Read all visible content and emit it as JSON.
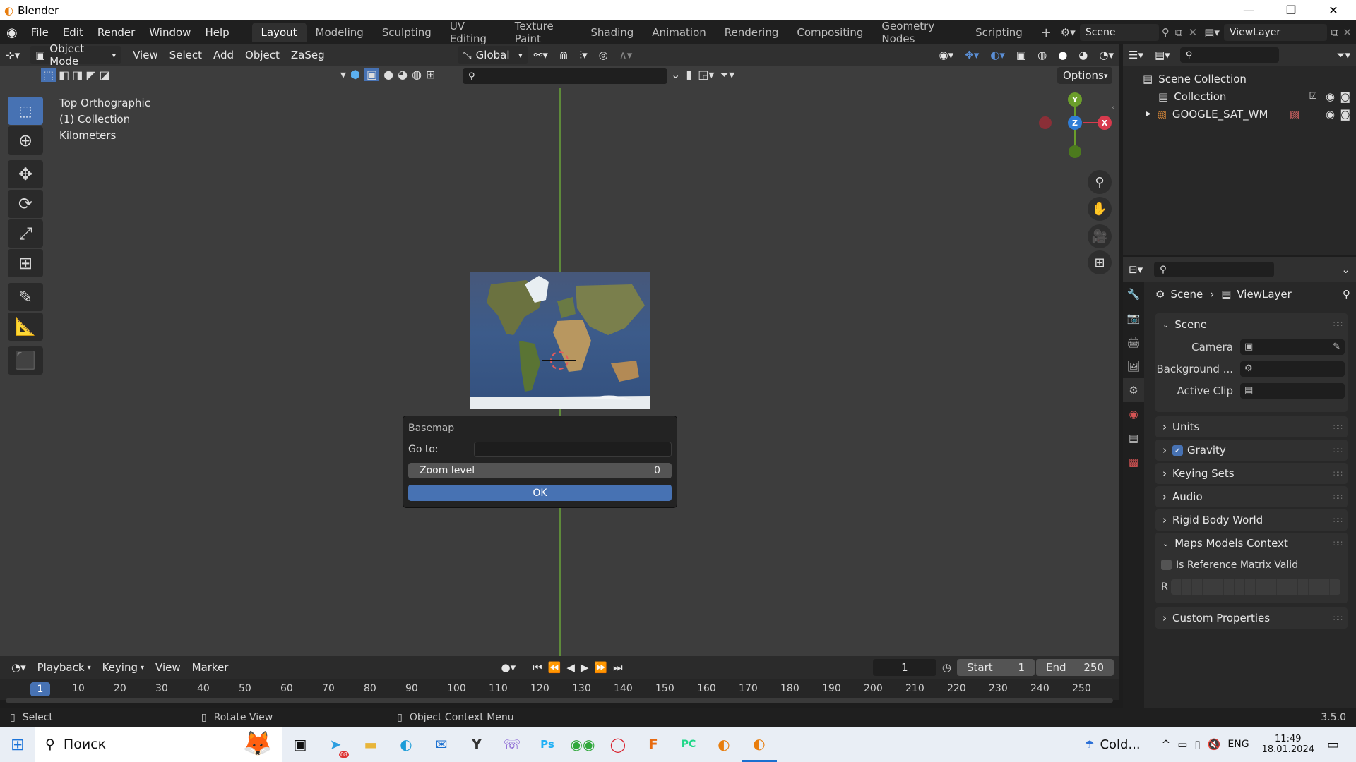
{
  "window": {
    "title": "Blender",
    "minimize": "—",
    "restore": "❐",
    "close": "✕"
  },
  "menus": [
    "File",
    "Edit",
    "Render",
    "Window",
    "Help"
  ],
  "workspaces": [
    "Layout",
    "Modeling",
    "Sculpting",
    "UV Editing",
    "Texture Paint",
    "Shading",
    "Animation",
    "Rendering",
    "Compositing",
    "Geometry Nodes",
    "Scripting"
  ],
  "active_workspace": "Layout",
  "scene_name": "Scene",
  "view_layer": "ViewLayer",
  "header": {
    "mode": "Object Mode",
    "menus": [
      "View",
      "Select",
      "Add",
      "Object",
      "ZaSeg"
    ],
    "orientation": "Global",
    "options": "Options"
  },
  "viewport": {
    "view_name": "Top Orthographic",
    "collection": "(1) Collection",
    "units": "Kilometers",
    "gizmo": {
      "y": "Y",
      "z": "Z",
      "x": "X"
    }
  },
  "dialog": {
    "title": "Basemap",
    "goto_label": "Go to:",
    "goto_value": "",
    "zoom_label": "Zoom level",
    "zoom_value": "0",
    "ok": "OK"
  },
  "outliner": {
    "root": "Scene Collection",
    "items": [
      "Collection",
      "GOOGLE_SAT_WM"
    ]
  },
  "properties": {
    "breadcrumb_scene": "Scene",
    "breadcrumb_layer": "ViewLayer",
    "scene_panel": "Scene",
    "camera_label": "Camera",
    "background_label": "Background ...",
    "active_clip_label": "Active Clip",
    "panels": [
      "Units",
      "Gravity",
      "Keying Sets",
      "Audio",
      "Rigid Body World"
    ],
    "maps_panel": "Maps Models Context",
    "ref_matrix": "Is Reference Matrix Valid",
    "r_label": "R",
    "custom_props": "Custom Properties"
  },
  "timeline": {
    "menus": [
      "Playback",
      "Keying",
      "View",
      "Marker"
    ],
    "current_frame": "1",
    "start_label": "Start",
    "start": "1",
    "end_label": "End",
    "end": "250",
    "ticks": [
      "10",
      "20",
      "30",
      "40",
      "50",
      "60",
      "70",
      "80",
      "90",
      "100",
      "110",
      "120",
      "130",
      "140",
      "150",
      "160",
      "170",
      "180",
      "190",
      "200",
      "210",
      "220",
      "230",
      "240",
      "250"
    ],
    "marker_frame": "1"
  },
  "status": {
    "select": "Select",
    "rotate": "Rotate View",
    "context": "Object Context Menu",
    "version": "3.5.0"
  },
  "taskbar": {
    "search": "Поиск",
    "weather": "Cold...",
    "lang": "ENG",
    "time": "11:49",
    "date": "18.01.2024",
    "telegram_badge": "08"
  },
  "colors": {
    "accent": "#4772b3",
    "x_axis": "#d83a4d",
    "y_axis": "#6b9e2b",
    "z_axis": "#2f7dd6"
  }
}
